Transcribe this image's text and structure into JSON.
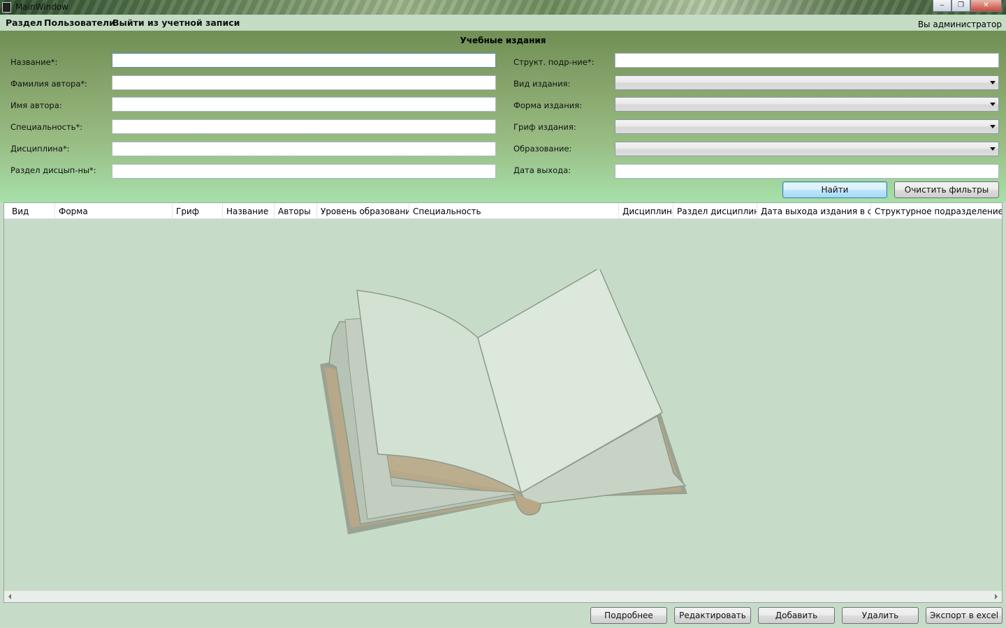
{
  "window": {
    "title": "MainWindow",
    "minimize": "‒",
    "maximize": "❐",
    "close": "✕"
  },
  "menu": {
    "items": [
      "Раздел",
      "Пользователи",
      "Выйти из учетной записи"
    ],
    "status": "Вы администратор"
  },
  "filters": {
    "title": "Учебные издания",
    "left": [
      {
        "label": "Название*:",
        "value": ""
      },
      {
        "label": "Фамилия автора*:",
        "value": ""
      },
      {
        "label": "Имя автора:",
        "value": ""
      },
      {
        "label": "Специальность*:",
        "value": ""
      },
      {
        "label": "Дисциплина*:",
        "value": ""
      },
      {
        "label": "Раздел дисцып-ны*:",
        "value": ""
      }
    ],
    "right": [
      {
        "label": "Структ. подр-ние*:",
        "value": "",
        "kind": "text"
      },
      {
        "label": "Вид издания:",
        "value": "",
        "kind": "combo"
      },
      {
        "label": "Форма издания:",
        "value": "",
        "kind": "combo"
      },
      {
        "label": "Гриф издания:",
        "value": "",
        "kind": "combo"
      },
      {
        "label": "Образование:",
        "value": "",
        "kind": "combo"
      },
      {
        "label": "Дата выхода:",
        "value": "",
        "kind": "text"
      }
    ],
    "find_button": "Найти",
    "clear_button": "Очистить фильтры"
  },
  "grid": {
    "columns": [
      "Вид",
      "Форма",
      "Гриф",
      "Название",
      "Авторы",
      "Уровень образования",
      "Специальность",
      "Дисциплина",
      "Раздел дисциплины",
      "Дата выхода издания в свет",
      "Структурное подразделение"
    ],
    "rows": [],
    "background_icon": "open-book-icon"
  },
  "actions": {
    "details": "Подробнее",
    "edit": "Редактировать",
    "add": "Добавить",
    "delete": "Удалить",
    "export": "Экспорт в excel"
  }
}
